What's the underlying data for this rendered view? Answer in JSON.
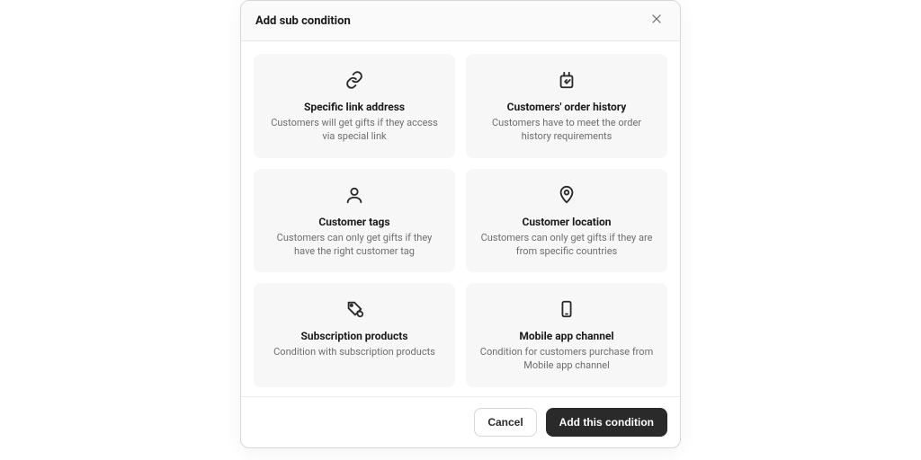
{
  "modal": {
    "title": "Add sub condition",
    "cards": [
      {
        "title": "Specific link address",
        "desc": "Customers will get gifts if they access via special link"
      },
      {
        "title": "Customers' order history",
        "desc": "Customers have to meet the order history requirements"
      },
      {
        "title": "Customer tags",
        "desc": "Customers can only get gifts if they have the right customer tag"
      },
      {
        "title": "Customer location",
        "desc": "Customers can only get gifts if they are from specific countries"
      },
      {
        "title": "Subscription products",
        "desc": "Condition with subscription products"
      },
      {
        "title": "Mobile app channel",
        "desc": "Condition for customers purchase from Mobile app channel"
      }
    ],
    "footer": {
      "cancel": "Cancel",
      "submit": "Add this condition"
    }
  }
}
